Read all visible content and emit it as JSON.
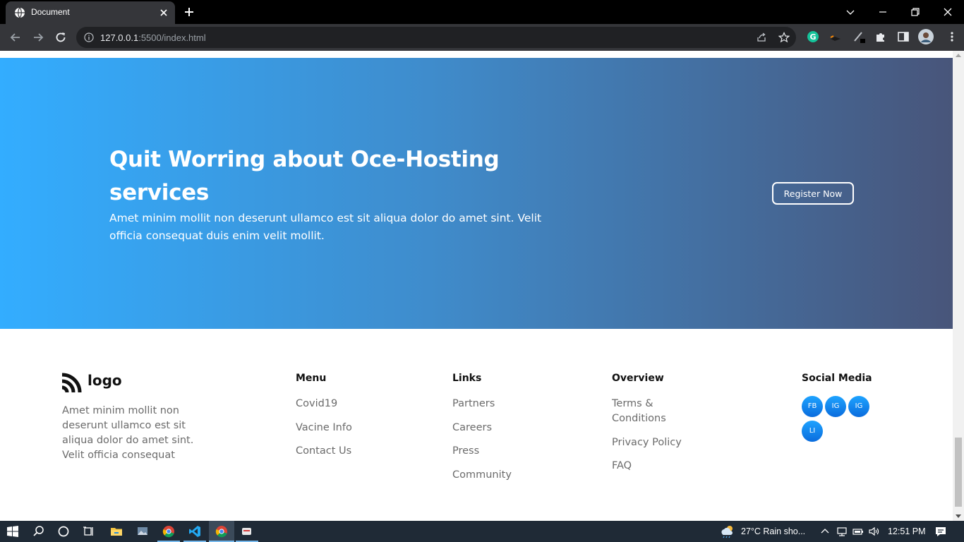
{
  "browser": {
    "tab_title": "Document",
    "url_host": "127.0.0.1",
    "url_rest": ":5500/index.html"
  },
  "hero": {
    "title": "Quit Worring about Oce-Hosting services",
    "text": "Amet minim mollit non deserunt ullamco est sit aliqua dolor do amet sint. Velit officia consequat duis enim velit mollit.",
    "button_label": "Register Now"
  },
  "footer": {
    "logo_text": "logo",
    "description": "Amet minim mollit non deserunt ullamco est sit aliqua dolor do amet sint. Velit officia consequat",
    "menu": {
      "heading": "Menu",
      "items": [
        "Covid19",
        "Vacine Info",
        "Contact Us"
      ]
    },
    "links": {
      "heading": "Links",
      "items": [
        "Partners",
        "Careers",
        "Press",
        "Community"
      ]
    },
    "overview": {
      "heading": "Overview",
      "items": [
        "Terms & Conditions",
        "Privacy Policy",
        "FAQ"
      ]
    },
    "social": {
      "heading": "Social Media",
      "items": [
        "FB",
        "IG",
        "IG",
        "LI"
      ]
    }
  },
  "taskbar": {
    "weather": "27°C  Rain sho...",
    "time": "12:51 PM"
  },
  "colors": {
    "hero_gradient_start": "#33adff",
    "hero_gradient_end": "#48557a",
    "social_button": "#1ea3ff"
  }
}
